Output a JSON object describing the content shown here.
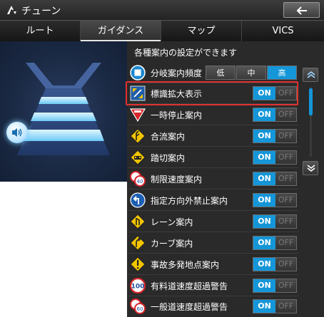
{
  "title": "チューン",
  "tabs": [
    {
      "label": "ルート",
      "active": false
    },
    {
      "label": "ガイダンス",
      "active": true
    },
    {
      "label": "マップ",
      "active": false
    },
    {
      "label": "VICS",
      "active": false
    }
  ],
  "header": "各種案内の設定ができます",
  "branch_row": {
    "label": "分岐案内頻度",
    "options": [
      "低",
      "中",
      "高"
    ],
    "selected": "高"
  },
  "toggle_on_label": "ON",
  "toggle_off_label": "OFF",
  "rows": [
    {
      "label": "標識拡大表示",
      "icon": "sign-enlarge-icon",
      "value": "ON",
      "highlighted": true
    },
    {
      "label": "一時停止案内",
      "icon": "stop-sign-icon",
      "value": "ON"
    },
    {
      "label": "合流案内",
      "icon": "merge-sign-icon",
      "value": "ON"
    },
    {
      "label": "踏切案内",
      "icon": "railroad-crossing-icon",
      "value": "ON"
    },
    {
      "label": "制限速度案内",
      "icon": "speed-limit-icon",
      "value": "ON"
    },
    {
      "label": "指定方向外禁止案内",
      "icon": "direction-sign-icon",
      "value": "ON"
    },
    {
      "label": "レーン案内",
      "icon": "lane-sign-icon",
      "value": "ON"
    },
    {
      "label": "カーブ案内",
      "icon": "curve-sign-icon",
      "value": "ON"
    },
    {
      "label": "事故多発地点案内",
      "icon": "warning-sign-icon",
      "value": "ON"
    },
    {
      "label": "有料道速度超過警告",
      "icon": "speed-100-icon",
      "value": "ON"
    },
    {
      "label": "一般道速度超過警告",
      "icon": "speed-60-icon",
      "value": "ON"
    }
  ],
  "colors": {
    "accent": "#1496d8",
    "highlight": "#e23030",
    "panel": "#2a2a2a"
  }
}
